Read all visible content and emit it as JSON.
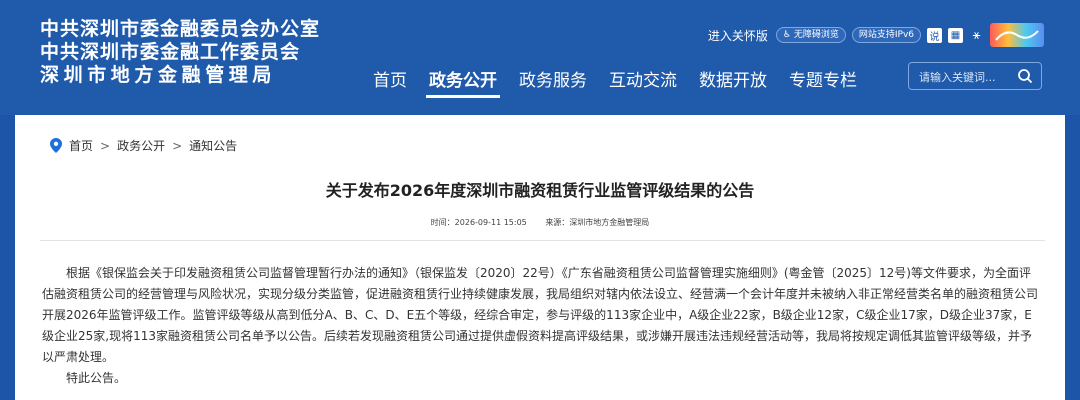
{
  "header": {
    "logo_lines": [
      "中共深圳市委金融委员会办公室",
      "中共深圳市委金融工作委员会",
      "深圳市地方金融管理局"
    ],
    "utility": {
      "care_mode": "进入关怀版",
      "accessibility": "无障碍浏览",
      "ipv6": "网站支持IPv6"
    },
    "nav": [
      "首页",
      "政务公开",
      "政务服务",
      "互动交流",
      "数据开放",
      "专题专栏"
    ],
    "active_nav": "政务公开",
    "search": {
      "placeholder": "请输入关键词..."
    }
  },
  "breadcrumb": [
    "首页",
    "政务公开",
    "通知公告"
  ],
  "article": {
    "title": "关于发布2026年度深圳市融资租赁行业监管评级结果的公告",
    "time": "时间：2026-09-11 15:05",
    "source": "来源：深圳市地方金融管理局",
    "body": "根据《银保监会关于印发融资租赁公司监督管理暂行办法的通知》（银保监发〔2020〕22号）《广东省融资租赁公司监督管理实施细则》(粤金管〔2025〕12号)等文件要求，为全面评估融资租赁公司的经营管理与风险状况，实现分级分类监管，促进融资租赁行业持续健康发展，我局组织对辖内依法设立、经营满一个会计年度并未被纳入非正常经营类名单的融资租赁公司开展2026年监管评级工作。监管评级等级从高到低分A、B、C、D、E五个等级，经综合审定，参与评级的113家企业中，A级企业22家，B级企业12家，C级企业17家，D级企业37家，E级企业25家,现将113家融资租赁公司名单予以公告。后续若发现融资租赁公司通过提供虚假资料提高评级结果，或涉嫌开展违法违规经营活动等，我局将按规定调低其监管评级等级，并予以严肃处理。",
    "closing": "特此公告。"
  },
  "colors": {
    "header_bg": "#1f5aab",
    "accent": "#1e6fd9"
  }
}
